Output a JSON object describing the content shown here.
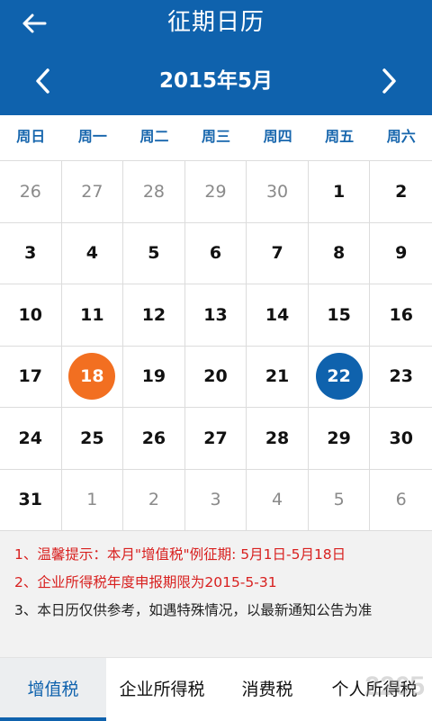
{
  "header": {
    "title": "征期日历"
  },
  "month_nav": {
    "title": "2015年5月"
  },
  "weekdays": [
    "周日",
    "周一",
    "周二",
    "周三",
    "周四",
    "周五",
    "周六"
  ],
  "calendar": {
    "days": [
      {
        "n": "26",
        "other": true
      },
      {
        "n": "27",
        "other": true
      },
      {
        "n": "28",
        "other": true
      },
      {
        "n": "29",
        "other": true
      },
      {
        "n": "30",
        "other": true
      },
      {
        "n": "1"
      },
      {
        "n": "2"
      },
      {
        "n": "3"
      },
      {
        "n": "4"
      },
      {
        "n": "5"
      },
      {
        "n": "6"
      },
      {
        "n": "7"
      },
      {
        "n": "8"
      },
      {
        "n": "9"
      },
      {
        "n": "10"
      },
      {
        "n": "11"
      },
      {
        "n": "12"
      },
      {
        "n": "13"
      },
      {
        "n": "14"
      },
      {
        "n": "15"
      },
      {
        "n": "16"
      },
      {
        "n": "17"
      },
      {
        "n": "18",
        "mark": "today"
      },
      {
        "n": "19"
      },
      {
        "n": "20"
      },
      {
        "n": "21"
      },
      {
        "n": "22",
        "mark": "deadline"
      },
      {
        "n": "23"
      },
      {
        "n": "24"
      },
      {
        "n": "25"
      },
      {
        "n": "26"
      },
      {
        "n": "27"
      },
      {
        "n": "28"
      },
      {
        "n": "29"
      },
      {
        "n": "30"
      },
      {
        "n": "31"
      },
      {
        "n": "1",
        "other": true
      },
      {
        "n": "2",
        "other": true
      },
      {
        "n": "3",
        "other": true
      },
      {
        "n": "4",
        "other": true
      },
      {
        "n": "5",
        "other": true
      },
      {
        "n": "6",
        "other": true
      }
    ],
    "colors": {
      "today": "#f26f21",
      "deadline": "#0f62ad"
    }
  },
  "notes": [
    "1、温馨提示：本月\"增值税\"例征期: 5月1日-5月18日",
    "2、企业所得税年度申报期限为2015-5-31",
    "3、本日历仅供参考，如遇特殊情况，以最新通知公告为准"
  ],
  "tabs": [
    {
      "label": "增值税",
      "active": true
    },
    {
      "label": "企业所得税"
    },
    {
      "label": "消费税"
    },
    {
      "label": "个人所得税"
    }
  ],
  "watermark": "2265"
}
